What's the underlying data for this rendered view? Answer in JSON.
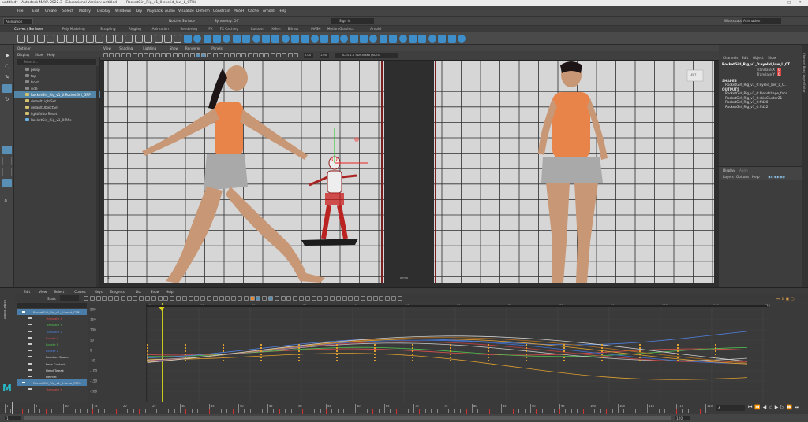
{
  "title": {
    "app": "untitled* - Autodesk MAYA 2022.3 - Educational Version: untitled",
    "file": "RocketGirl_Rig_v1_0:eyelid_low_L_CTRL"
  },
  "menu": [
    "File",
    "Edit",
    "Create",
    "Select",
    "Modify",
    "Display",
    "Windows",
    "Key",
    "Playback",
    "Audio",
    "Visualize",
    "Deform",
    "Constrain",
    "MASH",
    "Cache",
    "Arnold",
    "Help"
  ],
  "status": {
    "mode": "Animation",
    "live_surface": "No Live Surface",
    "symmetry": "Symmetry: Off",
    "signin": "Sign In",
    "workspace_label": "Workspace:",
    "workspace": "Animation"
  },
  "shelf_tabs": [
    "Curves / Surfaces",
    "Poly Modeling",
    "Sculpting",
    "Rigging",
    "Animation",
    "Rendering",
    "FX",
    "FX Caching",
    "Custom",
    "XGen",
    "Bifrost",
    "MASH",
    "Motion Graphics",
    "Arnold"
  ],
  "outliner": {
    "tabs": [
      "Display",
      "Show",
      "Help"
    ],
    "header": "Outliner",
    "search_placeholder": "Search...",
    "items": [
      "persp",
      "top",
      "front",
      "side",
      "RocketGirl_Rig_v1_0:RocketGirl_GRP",
      "defaultLightSet",
      "defaultObjectSet",
      "lightEditorReset",
      "RocketGirl_Rig_v1_0:Rfle"
    ]
  },
  "viewport": {
    "menu": [
      "View",
      "Shading",
      "Lighting",
      "Show",
      "Renderer",
      "Panels"
    ],
    "field1": "0.00",
    "field2": "1.00",
    "colorspace": "ACES 1.0 SDR-video (ACES)",
    "right_panel_label": "LEFT",
    "left_panel_label": "persp"
  },
  "channelbox": {
    "tabs": [
      "Channels",
      "Edit",
      "Object",
      "Show"
    ],
    "object": "RocketGirl_Rig_v1_0:eyelid_low_L_CT...",
    "attrs": [
      {
        "name": "Translate X",
        "value": "0"
      },
      {
        "name": "Translate Y",
        "value": "0"
      }
    ],
    "shapes_header": "SHAPES",
    "shapes": [
      "RocketGirl_Rig_v1_0:eyelid_low_L_C..."
    ],
    "outputs_header": "OUTPUTS",
    "outputs": [
      "RocketGirl_Rig_v1_0:blendshape_face",
      "RocketGirl_Rig_v1_0:skinCluster21",
      "RocketGirl_Rig_v1_0:ffd20",
      "RocketGirl_Rig_v1_0:ffd22"
    ],
    "layer_tabs": [
      "Display",
      "Anim"
    ],
    "layer_menu": [
      "Layers",
      "Options",
      "Help"
    ],
    "side_tabs": "Channel Box / Layer Editor"
  },
  "graph": {
    "menu": [
      "Edit",
      "View",
      "Select",
      "Curves",
      "Keys",
      "Tangents",
      "List",
      "Show",
      "Help"
    ],
    "stats_label": "Stats",
    "side_label": "Graph Editor",
    "curves": [
      {
        "name": "RocketGirl_Rig_v1_0:head_CTRL",
        "color": "#dddddd",
        "sel": true
      },
      {
        "name": "Translate X",
        "color": "#e05050"
      },
      {
        "name": "Translate Y",
        "color": "#50c050"
      },
      {
        "name": "Translate Z",
        "color": "#5080e0"
      },
      {
        "name": "Rotate X",
        "color": "#e05050"
      },
      {
        "name": "Rotate Y",
        "color": "#50c050"
      },
      {
        "name": "Rotate Z",
        "color": "#5080e0"
      },
      {
        "name": "Rotation Space",
        "color": "#dddddd"
      },
      {
        "name": "Face Controls",
        "color": "#dddddd"
      },
      {
        "name": "Head Tweak",
        "color": "#dddddd"
      },
      {
        "name": "Helmet",
        "color": "#dddddd"
      },
      {
        "name": "RocketGirl_Rig_v1_0:torso_CTRL",
        "color": "#dddddd",
        "sel": true
      },
      {
        "name": "Translate X",
        "color": "#e05050"
      }
    ],
    "y_ticks": [
      "200",
      "150",
      "100",
      "50",
      "0",
      "-50",
      "-100",
      "-150",
      "-200"
    ],
    "x_ticks": [
      "1",
      "10",
      "20",
      "30",
      "40",
      "50",
      "60",
      "70",
      "80",
      "90",
      "100",
      "110",
      "120"
    ]
  },
  "timeline": {
    "ticks": [
      "1",
      "5",
      "10",
      "15",
      "20",
      "25",
      "30",
      "35",
      "40",
      "45",
      "50",
      "55",
      "60",
      "65",
      "70",
      "75",
      "80",
      "85",
      "90",
      "95",
      "100",
      "105",
      "110",
      "115",
      "120"
    ],
    "current_frame": "4",
    "start": "1",
    "end": "120"
  },
  "colors": {
    "accent": "#5285a6",
    "selection": "#4a7da7",
    "ui_bg": "#444444"
  }
}
